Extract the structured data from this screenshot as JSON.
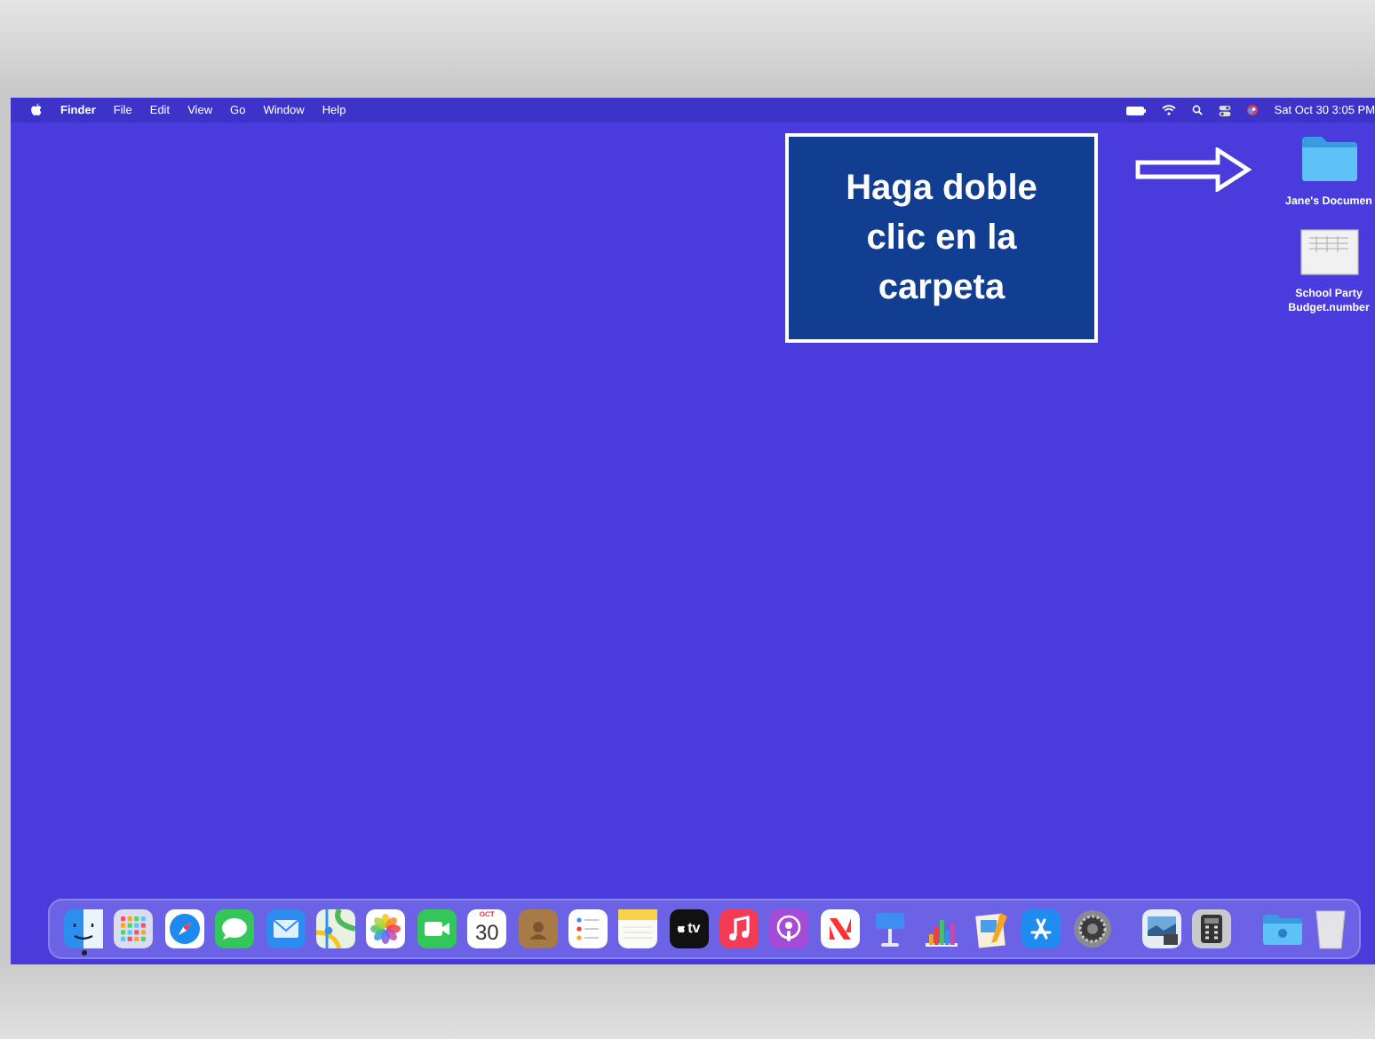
{
  "menu_bar": {
    "app_name": "Finder",
    "menus": [
      "File",
      "Edit",
      "View",
      "Go",
      "Window",
      "Help"
    ],
    "clock": "Sat Oct 30 3:05 PM"
  },
  "callout": {
    "text": "Haga doble clic en la carpeta"
  },
  "desktop_items": [
    {
      "kind": "folder",
      "label": "Jane's Documen"
    },
    {
      "kind": "spreadsheet",
      "label": "School Party Budget.number"
    }
  ],
  "dock": {
    "calendar_month": "OCT",
    "calendar_day": "30",
    "tv_label": "tv"
  }
}
